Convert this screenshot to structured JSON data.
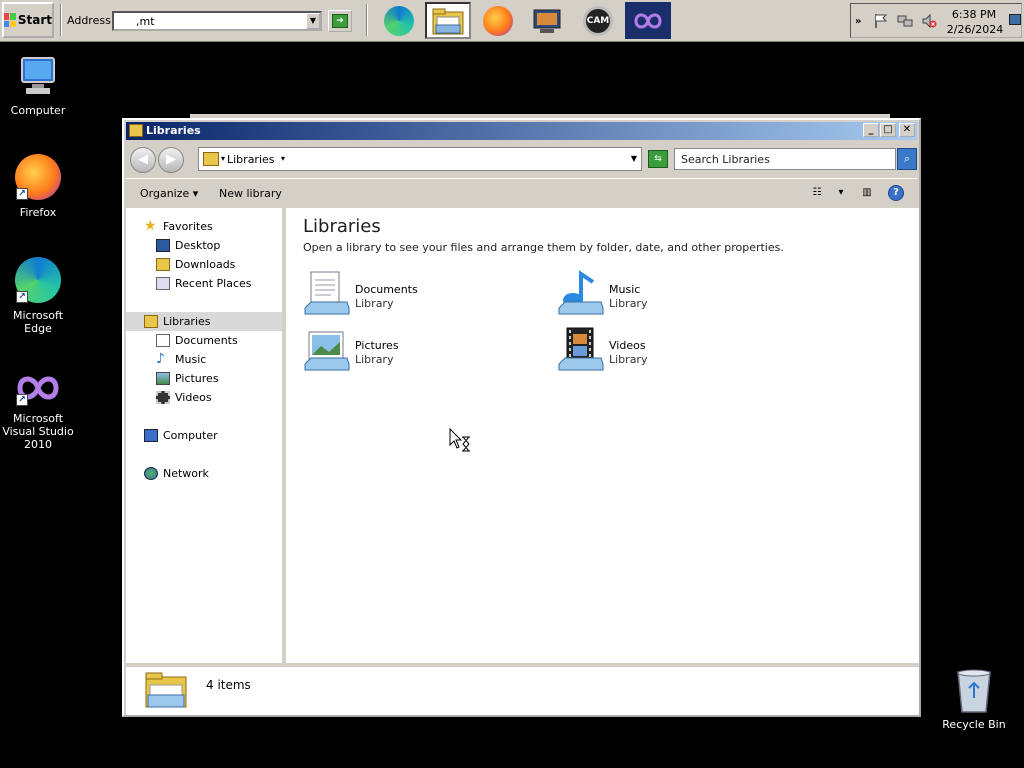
{
  "taskbar": {
    "start_label": "Start",
    "address_label": "Address",
    "address_value": ",mt",
    "pinned": [
      "edge-icon",
      "file-explorer-icon",
      "firefox-icon",
      "media-center-icon",
      "cam-icon",
      "visual-studio-icon"
    ],
    "clock_time": "6:38 PM",
    "clock_date": "2/26/2024"
  },
  "desktop": {
    "icons": [
      {
        "label": "Computer"
      },
      {
        "label": "Firefox"
      },
      {
        "label": "Microsoft Edge"
      },
      {
        "label": "Microsoft Visual Studio 2010"
      },
      {
        "label": "Recycle Bin"
      }
    ]
  },
  "window": {
    "title": "Libraries",
    "breadcrumb": "Libraries",
    "search_placeholder": "Search Libraries",
    "commands": {
      "organize": "Organize",
      "new_library": "New library"
    },
    "nav": {
      "favorites": "Favorites",
      "desktop": "Desktop",
      "downloads": "Downloads",
      "recent": "Recent Places",
      "libraries": "Libraries",
      "documents": "Documents",
      "music": "Music",
      "pictures": "Pictures",
      "videos": "Videos",
      "computer": "Computer",
      "network": "Network"
    },
    "content": {
      "heading": "Libraries",
      "description": "Open a library to see your files and arrange them by folder, date, and other properties.",
      "libraries": [
        {
          "name": "Documents",
          "type": "Library"
        },
        {
          "name": "Music",
          "type": "Library"
        },
        {
          "name": "Pictures",
          "type": "Library"
        },
        {
          "name": "Videos",
          "type": "Library"
        }
      ]
    },
    "status": "4 items"
  },
  "colors": {
    "titlebar_start": "#0a246a",
    "titlebar_end": "#a6caf0",
    "chrome": "#d4d0c8",
    "desktop": "#000000"
  }
}
